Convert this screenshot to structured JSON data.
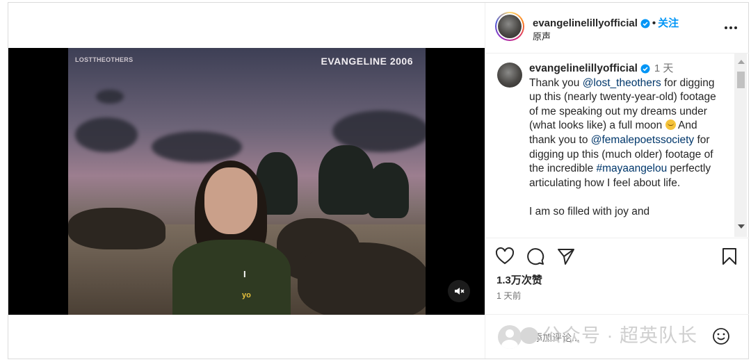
{
  "video": {
    "watermark_left": "LOSTTHEOTHERS",
    "watermark_right": "EVANGELINE 2006",
    "subtitle_line1": "I",
    "subtitle_line2": "yo"
  },
  "post": {
    "username": "evangelinelillyofficial",
    "separator": "•",
    "follow_label": "关注",
    "audio_label": "原声"
  },
  "caption": {
    "username": "evangelinelillyofficial",
    "time": "1 天",
    "text_1": "Thank you ",
    "mention_1": "@lost_theothers",
    "text_2": " for digging up this (nearly twenty-year-old) footage of me speaking out my dreams under (what looks like) a full moon ",
    "text_3": " And thank you to ",
    "mention_2": "@femalepoetssociety",
    "text_4": " for digging up this (much older) footage of the incredible ",
    "hashtag": "#mayaangelou",
    "text_5": " perfectly articulating how I feel about life.",
    "paragraph_2": "I am so filled with joy and"
  },
  "stats": {
    "likes": "1.3万次赞",
    "date": "1 天前"
  },
  "comment_box": {
    "placeholder": "添加评论...",
    "overlay_watermark": "公众号 · 超英队长"
  },
  "colors": {
    "link": "#00376b",
    "follow": "#0095f6",
    "muted": "#737373"
  },
  "icons": [
    "verified-badge-icon",
    "more-options-icon",
    "heart-icon",
    "comment-icon",
    "share-icon",
    "bookmark-icon",
    "emoji-icon",
    "mute-icon"
  ]
}
